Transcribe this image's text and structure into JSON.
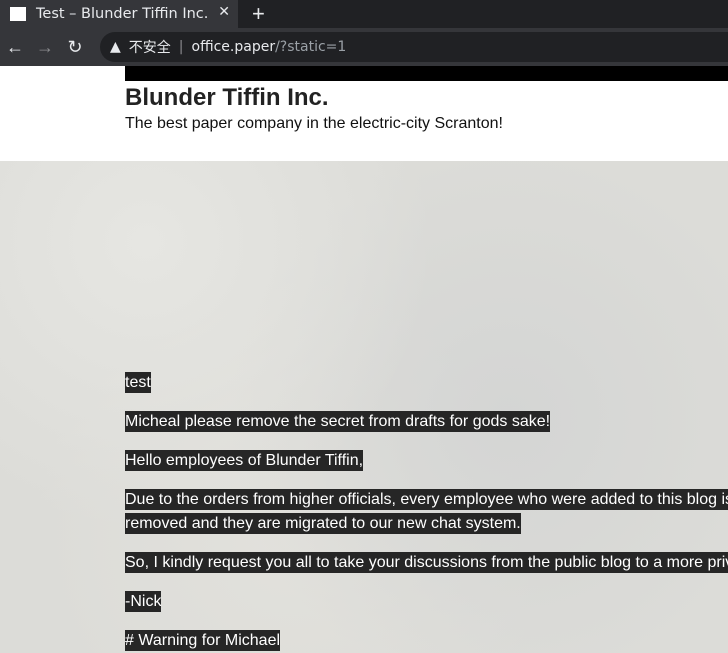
{
  "browser": {
    "tab_title": "Test – Blunder Tiffin Inc.",
    "favicon_text": "BLUNDER TIFFIN",
    "close": "✕",
    "new_tab": "+",
    "security_label": "不安全",
    "url_host": "office.paper",
    "url_path": "/?static=1"
  },
  "site": {
    "title": "Blunder Tiffin Inc.",
    "subtitle": "The best paper company in the electric-city Scranton!"
  },
  "posts": [
    "test",
    "Micheal please remove the secret from drafts for gods sake!",
    "Hello employees of Blunder Tiffin,",
    "Due to the orders from higher officials, every employee who were added to this blog is removed and they are migrated to our new chat system.",
    "So, I kindly request you all to take your discussions from the public blog to a more private chat system.",
    "-Nick",
    "# Warning for Michael"
  ]
}
